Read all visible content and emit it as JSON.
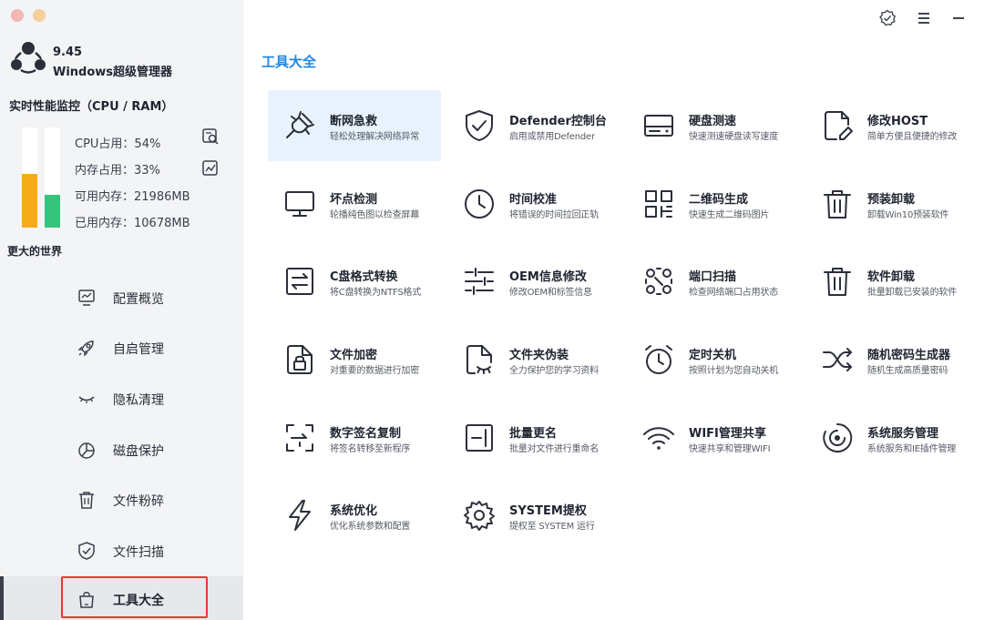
{
  "app": {
    "version": "9.45",
    "name": "Windows超级管理器"
  },
  "monitor": {
    "title": "实时性能监控（CPU / RAM）",
    "cpu_label": "CPU占用：54%",
    "ram_label": "内存占用：33%",
    "avail_label": "可用内存：21986MB",
    "used_label": "已用内存：10678MB",
    "cpu_percent": 54,
    "ram_percent": 33,
    "cpu_color": "#f7aa18",
    "ram_color": "#35c47d"
  },
  "sidebar": {
    "section": "更大的世界",
    "items": [
      {
        "label": "配置概览",
        "icon": "monitor-chart-icon"
      },
      {
        "label": "自启管理",
        "icon": "rocket-icon"
      },
      {
        "label": "隐私清理",
        "icon": "closed-eye-icon"
      },
      {
        "label": "磁盘保护",
        "icon": "pie-chart-icon"
      },
      {
        "label": "文件粉碎",
        "icon": "trash-icon"
      },
      {
        "label": "文件扫描",
        "icon": "shield-check-icon"
      },
      {
        "label": "工具大全",
        "icon": "bag-icon",
        "active": true
      }
    ]
  },
  "main": {
    "title": "工具大全",
    "accent_color": "#1e88e5",
    "tools": [
      {
        "name": "断网急救",
        "desc": "轻松处理解决网络异常",
        "icon": "plug-icon"
      },
      {
        "name": "Defender控制台",
        "desc": "启用或禁用Defender",
        "icon": "shield-check-icon"
      },
      {
        "name": "硬盘测速",
        "desc": "快速测速硬盘读写速度",
        "icon": "hard-disk-icon"
      },
      {
        "name": "修改HOST",
        "desc": "简单方便且便捷的修改",
        "icon": "file-edit-icon"
      },
      {
        "name": "坏点检测",
        "desc": "轮播纯色图以检查屏幕",
        "icon": "monitor-icon"
      },
      {
        "name": "时间校准",
        "desc": "将错误的时间拉回正轨",
        "icon": "clock-icon"
      },
      {
        "name": "二维码生成",
        "desc": "快速生成二维码图片",
        "icon": "qr-code-icon"
      },
      {
        "name": "预装卸载",
        "desc": "卸载Win10预装软件",
        "icon": "trash-icon"
      },
      {
        "name": "C盘格式转换",
        "desc": "将C盘转换为NTFS格式",
        "icon": "convert-icon"
      },
      {
        "name": "OEM信息修改",
        "desc": "修改OEM和标签信息",
        "icon": "sliders-icon"
      },
      {
        "name": "端口扫描",
        "desc": "检查网络端口占用状态",
        "icon": "port-scan-icon"
      },
      {
        "name": "软件卸载",
        "desc": "批量卸载已安装的软件",
        "icon": "trash-icon"
      },
      {
        "name": "文件加密",
        "desc": "对重要的数据进行加密",
        "icon": "file-lock-icon"
      },
      {
        "name": "文件夹伪装",
        "desc": "全力保护您的学习资料",
        "icon": "file-mask-icon"
      },
      {
        "name": "定时关机",
        "desc": "按照计划为您自动关机",
        "icon": "alarm-clock-icon"
      },
      {
        "name": "随机密码生成器",
        "desc": "随机生成高质量密码",
        "icon": "shuffle-icon"
      },
      {
        "name": "数字签名复制",
        "desc": "将签名转移至新程序",
        "icon": "signature-copy-icon"
      },
      {
        "name": "批量更名",
        "desc": "批量对文件进行重命名",
        "icon": "rename-icon"
      },
      {
        "name": "WIFI管理共享",
        "desc": "快速共享和管理WIFI",
        "icon": "wifi-icon"
      },
      {
        "name": "系统服务管理",
        "desc": "系统服务和IE插件管理",
        "icon": "service-ring-icon"
      },
      {
        "name": "系统优化",
        "desc": "优化系统参数和配置",
        "icon": "lightning-icon"
      },
      {
        "name": "SYSTEM提权",
        "desc": "提权至 SYSTEM 运行",
        "icon": "gear-icon"
      }
    ]
  }
}
